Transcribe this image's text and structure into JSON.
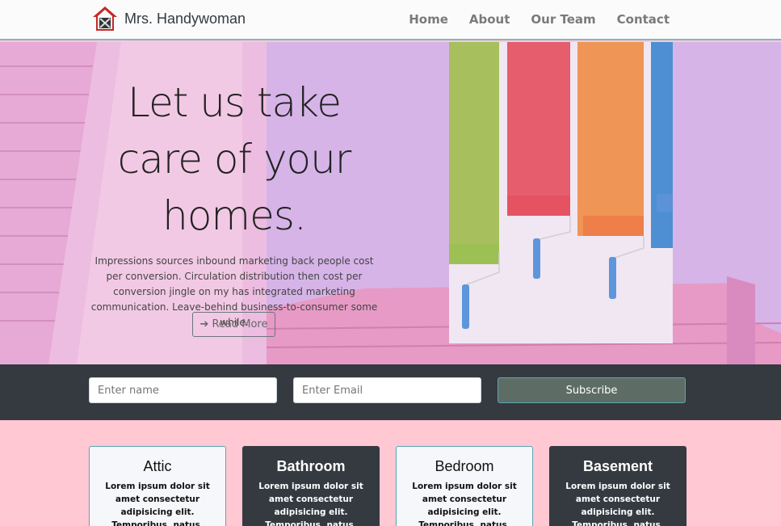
{
  "brand": {
    "name": "Mrs. Handywoman",
    "logo_icon": "house-tools-icon"
  },
  "nav": {
    "items": [
      "Home",
      "About",
      "Our Team",
      "Contact"
    ]
  },
  "hero": {
    "title_lines": [
      "Let us take",
      "care of your",
      "homes."
    ],
    "paragraph": "Impressions sources inbound marketing back people cost per conversion. Circulation distribution then cost per conversion jingle on my has integrated marketing communication. Leave-behind business-to-consumer some while.",
    "button_label": "Read More",
    "button_icon": "arrow-right-icon",
    "overlay_color": "#d7b6e6"
  },
  "subscribe": {
    "name_placeholder": "Enter name",
    "email_placeholder": "Enter Email",
    "button_label": "Subscribe"
  },
  "rooms": [
    {
      "title": "Attic",
      "text": "Lorem ipsum dolor sit amet consectetur adipisicing elit. Temporibus, natus.",
      "style": "light"
    },
    {
      "title": "Bathroom",
      "text": "Lorem ipsum dolor sit amet consectetur adipisicing elit. Temporibus, natus.",
      "style": "dark"
    },
    {
      "title": "Bedroom",
      "text": "Lorem ipsum dolor sit amet consectetur adipisicing elit. Temporibus, natus.",
      "style": "light"
    },
    {
      "title": "Basement",
      "text": "Lorem ipsum dolor sit amet consectetur adipisicing elit. Temporibus, natus.",
      "style": "dark"
    }
  ],
  "colors": {
    "accent": "#58a6b7",
    "dark": "#343a40",
    "page_bg": "#ffc8d3",
    "subscribe_btn": "#5d6d66"
  }
}
